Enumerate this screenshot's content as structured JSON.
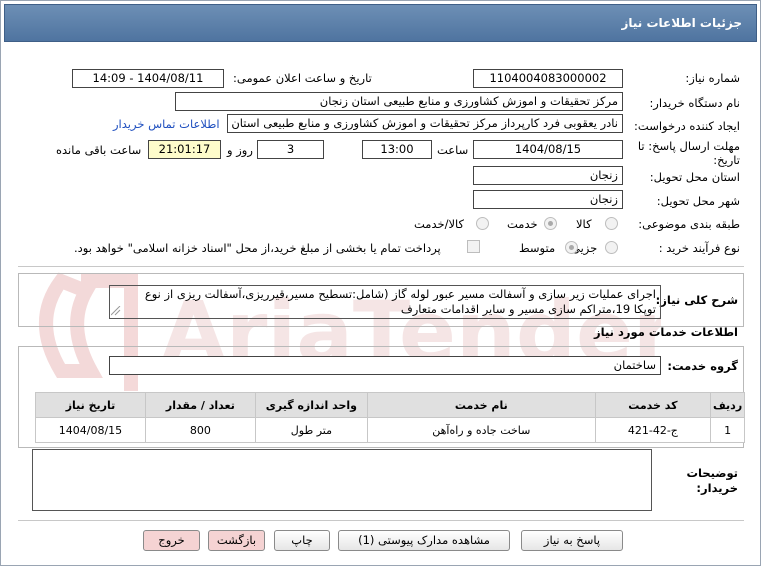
{
  "window": {
    "title": "جزئیات اطلاعات نیاز"
  },
  "fields": {
    "need_number": {
      "label": "شماره نیاز:",
      "value": "1104004083000002"
    },
    "announce_datetime": {
      "label": "تاریخ و ساعت اعلان عمومی:",
      "value": "1404/08/11 - 14:09"
    },
    "buyer_org": {
      "label": "نام دستگاه خریدار:",
      "value": "مرکز تحقیقات و اموزش کشاورزی و منابع طبیعی استان زنجان"
    },
    "requester": {
      "label": "ایجاد کننده درخواست:",
      "value": "نادر یعقوبی فرد کارپرداز مرکز تحقیقات و اموزش کشاورزی و منابع طبیعی استان",
      "contact_link": "اطلاعات تماس خریدار"
    },
    "deadline": {
      "label_line1": "مهلت ارسال پاسخ: تا",
      "label_line2": "تاریخ:",
      "date": "1404/08/15",
      "time_label": "ساعت",
      "time": "13:00",
      "days": "3",
      "days_label": "روز و",
      "remaining": "21:01:17",
      "remaining_label": "ساعت باقی مانده"
    },
    "province": {
      "label": "استان محل تحویل:",
      "value": "زنجان"
    },
    "city": {
      "label": "شهر محل تحویل:",
      "value": "زنجان"
    },
    "category": {
      "label": "طبقه بندی موضوعی:",
      "options": [
        "کالا",
        "خدمت",
        "کالا/خدمت"
      ],
      "selected": "خدمت"
    },
    "purchase_type": {
      "label": "نوع فرآیند خرید :",
      "options": [
        "جزیی",
        "متوسط"
      ],
      "selected": "متوسط",
      "note": "پرداخت تمام یا بخشی از مبلغ خرید،از محل \"اسناد خزانه اسلامی\" خواهد بود."
    }
  },
  "description": {
    "label": "شرح کلی نیاز:",
    "text_line1": "اجرای عملیات زیر سازی و آسفالت مسیر عبور لوله گاز (شامل:تسطیح مسیر،قیرریزی،آسفالت ریزی از نوع",
    "text_line2": "توپکا 19،متراکم سازی مسیر و سایر اقدامات متعارف"
  },
  "services": {
    "header": "اطلاعات خدمات مورد نیاز",
    "group_label": "گروه خدمت:",
    "group_value": "ساختمان",
    "columns": [
      "ردیف",
      "کد خدمت",
      "نام خدمت",
      "واحد اندازه گیری",
      "تعداد / مقدار",
      "تاریخ نیاز"
    ],
    "rows": [
      [
        "1",
        "ج-42-421",
        "ساخت جاده و راه‌آهن",
        "متر طول",
        "800",
        "1404/08/15"
      ]
    ]
  },
  "buyer_notes": {
    "label_line1": "توضیحات",
    "label_line2": "خریدار:",
    "value": ""
  },
  "buttons": {
    "reply": "پاسخ به نیاز",
    "attachments": "مشاهده مدارک پیوستی (1)",
    "print": "چاپ",
    "back": "بازگشت",
    "exit": "خروج"
  },
  "colors": {
    "title_bar": "#5a7faa",
    "link": "#1f4fbf",
    "remaining_bg": "#fefccb"
  }
}
